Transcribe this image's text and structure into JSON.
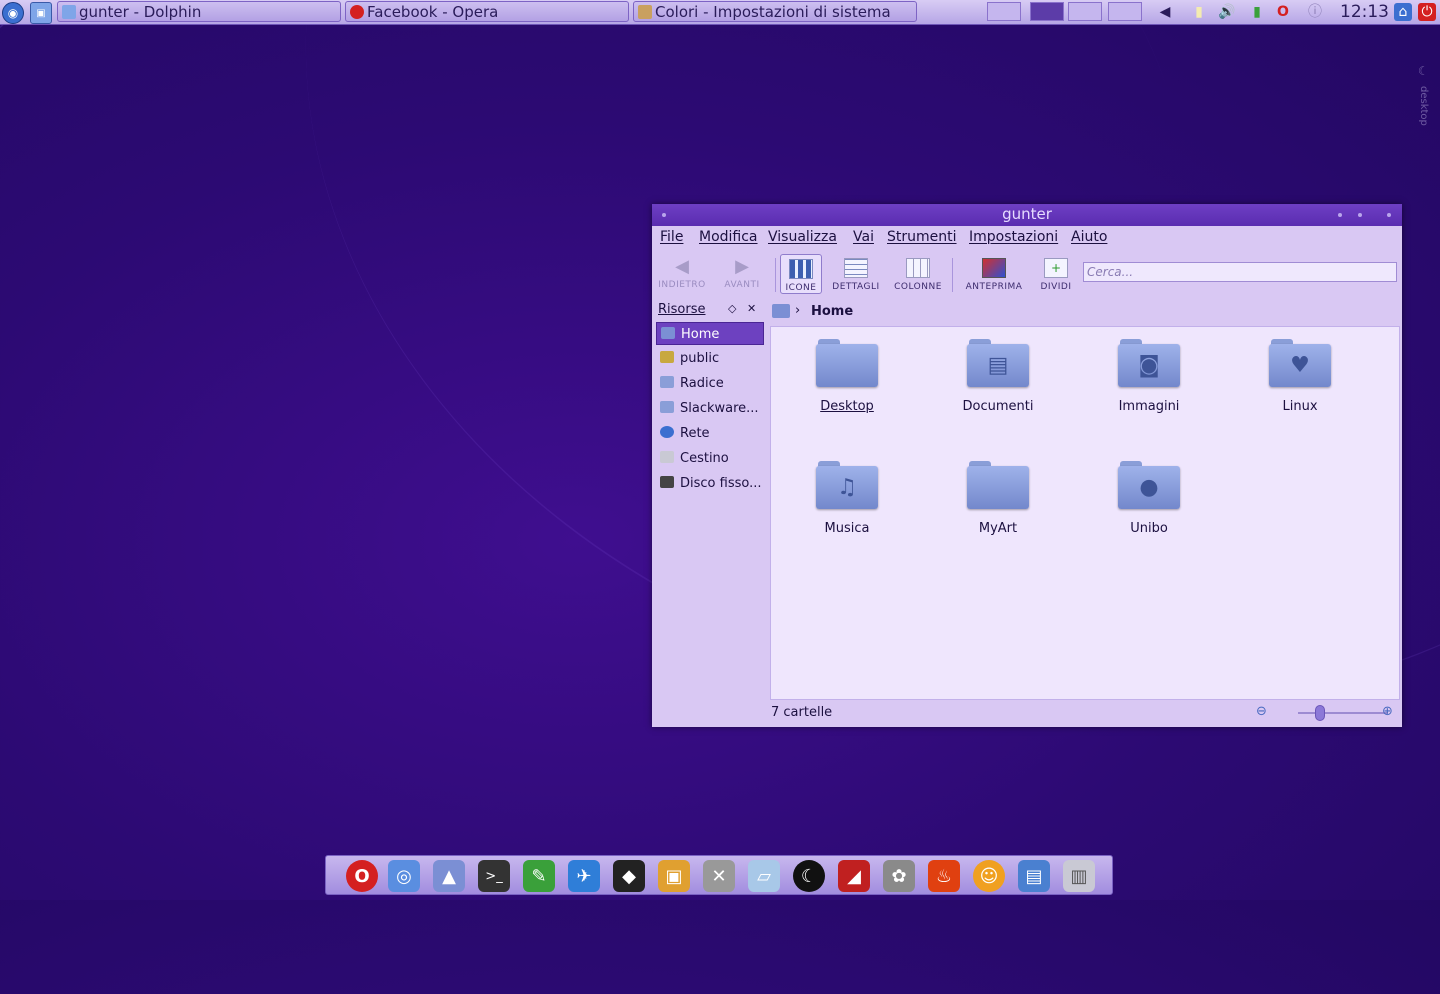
{
  "taskbar": {
    "tasks": [
      {
        "label": "gunter - Dolphin"
      },
      {
        "label": "Facebook - Opera"
      },
      {
        "label": "Colori - Impostazioni di sistema"
      }
    ],
    "clock": "12:13"
  },
  "desktop_applet": {
    "label": "desktop"
  },
  "window": {
    "title": "gunter",
    "menu": [
      "File",
      "Modifica",
      "Visualizza",
      "Vai",
      "Strumenti",
      "Impostazioni",
      "Aiuto"
    ],
    "toolbar": {
      "back": "INDIETRO",
      "forward": "AVANTI",
      "icons": "ICONE",
      "details": "DETTAGLI",
      "columns": "COLONNE",
      "preview": "ANTEPRIMA",
      "split": "DIVIDI",
      "search_placeholder": "Cerca..."
    },
    "sidebar": {
      "title": "Risorse",
      "places": [
        {
          "label": "Home",
          "icon": "home-folder-icon"
        },
        {
          "label": "public",
          "icon": "shared-folder-icon"
        },
        {
          "label": "Radice",
          "icon": "folder-icon"
        },
        {
          "label": "Slackware...",
          "icon": "folder-icon"
        },
        {
          "label": "Rete",
          "icon": "network-icon"
        },
        {
          "label": "Cestino",
          "icon": "trash-icon"
        },
        {
          "label": "Disco fisso...",
          "icon": "hard-disk-icon"
        }
      ]
    },
    "breadcrumb": {
      "current": "Home"
    },
    "items": [
      {
        "label": "Desktop",
        "icon": "folder-icon"
      },
      {
        "label": "Documenti",
        "icon": "folder-documents-icon"
      },
      {
        "label": "Immagini",
        "icon": "folder-pictures-icon"
      },
      {
        "label": "Linux",
        "icon": "folder-heart-icon"
      },
      {
        "label": "Musica",
        "icon": "folder-music-icon"
      },
      {
        "label": "MyArt",
        "icon": "folder-icon"
      },
      {
        "label": "Unibo",
        "icon": "folder-user-icon"
      }
    ],
    "status": "7 cartelle"
  },
  "dock": {
    "icons": [
      "opera-icon",
      "browser-icon",
      "user-folder-icon",
      "terminal-icon",
      "chat-icon",
      "bird-icon",
      "inkscape-icon",
      "image-viewer-icon",
      "tools-icon",
      "notes-icon",
      "wolf-icon",
      "pdf-icon",
      "gimp-icon",
      "burner-icon",
      "messenger-icon",
      "office-icon",
      "trash-icon"
    ]
  }
}
